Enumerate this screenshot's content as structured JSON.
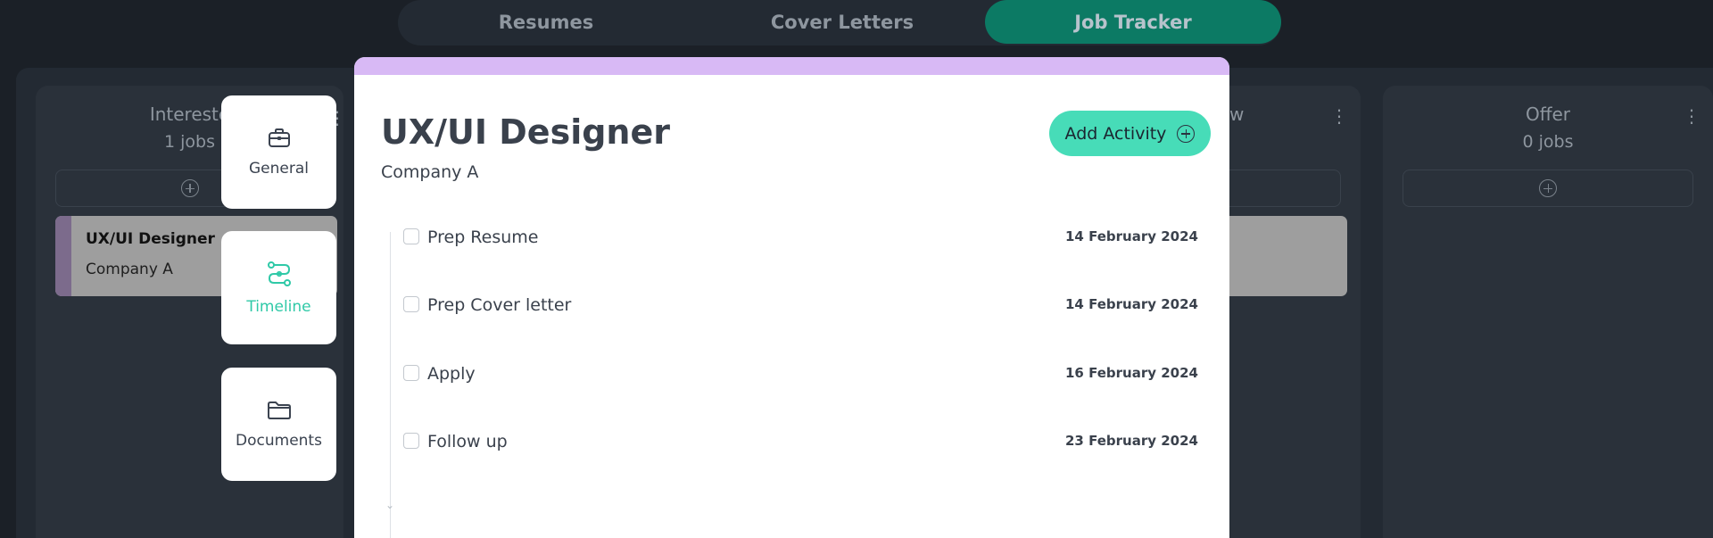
{
  "top_tabs": [
    {
      "label": "Resumes"
    },
    {
      "label": "Cover Letters"
    },
    {
      "label": "Job Tracker"
    }
  ],
  "board": {
    "columns": [
      {
        "title": "Intereste",
        "count": "1 jobs"
      },
      {
        "title": "w",
        "count": ""
      },
      {
        "title": "Offer",
        "count": "0 jobs"
      }
    ],
    "card": {
      "title": "UX/UI Designer",
      "company": "Company A"
    }
  },
  "side_nav": [
    {
      "label": "General",
      "icon": "briefcase-icon"
    },
    {
      "label": "Timeline",
      "icon": "route-icon"
    },
    {
      "label": "Documents",
      "icon": "folder-icon"
    }
  ],
  "modal": {
    "title": "UX/UI Designer",
    "company": "Company A",
    "add_activity_label": "Add Activity",
    "activities": [
      {
        "name": "Prep Resume",
        "date": "14 February 2024"
      },
      {
        "name": "Prep Cover letter",
        "date": "14 February 2024"
      },
      {
        "name": "Apply",
        "date": "16 February 2024"
      },
      {
        "name": "Follow up",
        "date": "23 February 2024"
      }
    ]
  },
  "colors": {
    "active_tab": "#0c7a64",
    "accent": "#47dcb8",
    "timeline_active": "#2fc9a7",
    "modal_header": "#d8b9f5",
    "card_stripe": "#7c6b8c"
  }
}
